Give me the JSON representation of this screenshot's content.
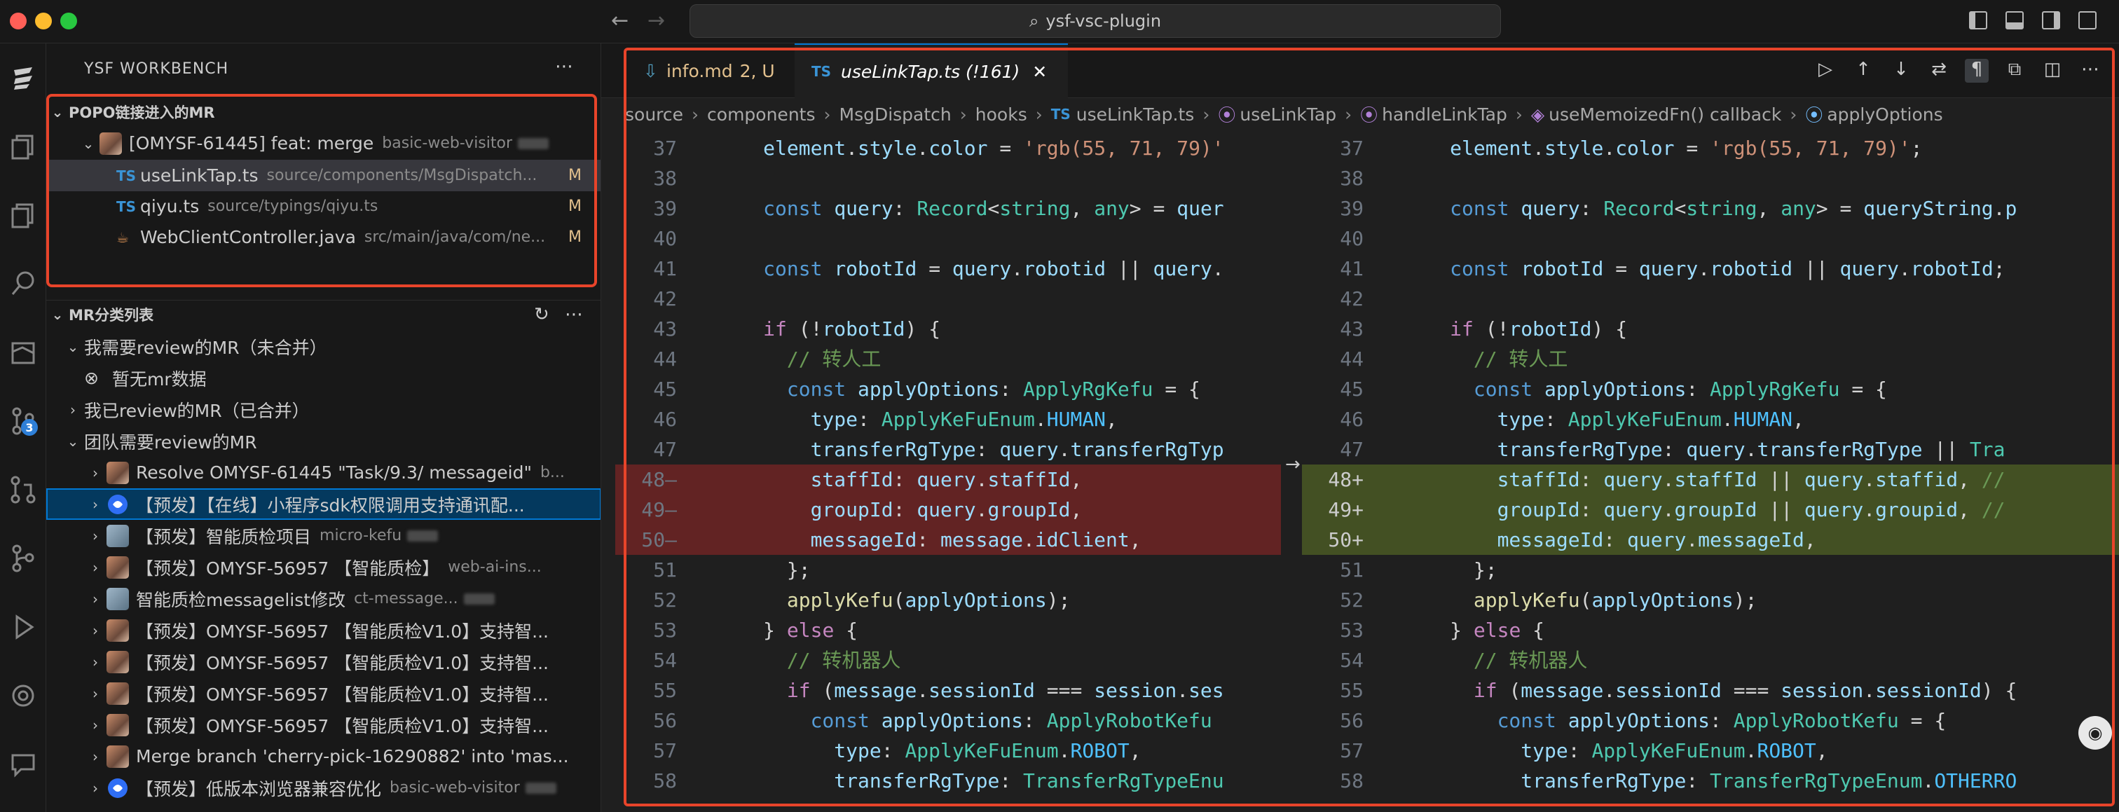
{
  "window": {
    "search_text": "ysf-vsc-plugin"
  },
  "activity": {
    "source_control_badge": "3"
  },
  "sidebar": {
    "title": "YSF WORKBENCH",
    "popo_section": {
      "header": "POPO链接进入的MR",
      "mr": {
        "title": "[OMYSF-61445] feat: merge",
        "branch": "basic-web-visitor"
      },
      "files": [
        {
          "icon": "TS",
          "name": "useLinkTap.ts",
          "path": "source/components/MsgDispatch...",
          "status": "M"
        },
        {
          "icon": "TS",
          "name": "qiyu.ts",
          "path": "source/typings/qiyu.ts",
          "status": "M"
        },
        {
          "icon": "java",
          "name": "WebClientController.java",
          "path": "src/main/java/com/ne...",
          "status": "M"
        }
      ]
    },
    "mr_section": {
      "header": "MR分类列表",
      "groups": [
        {
          "label": "我需要review的MR（未合并）"
        },
        {
          "label": "暂无mr数据"
        },
        {
          "label": "我已review的MR（已合并）"
        },
        {
          "label": "团队需要review的MR"
        }
      ],
      "items": [
        {
          "title": "Resolve OMYSF-61445 \"Task/9.3/ messageid\"",
          "desc": "b..."
        },
        {
          "title": "【预发】【在线】小程序sdk权限调用支持通讯配...",
          "desc": ""
        },
        {
          "title": "【预发】智能质检项目",
          "desc": "micro-kefu"
        },
        {
          "title": "【预发】OMYSF-56957 【智能质检】",
          "desc": "web-ai-ins..."
        },
        {
          "title": "智能质检messagelist修改",
          "desc": "ct-message..."
        },
        {
          "title": "【预发】OMYSF-56957 【智能质检V1.0】支持智...",
          "desc": ""
        },
        {
          "title": "【预发】OMYSF-56957 【智能质检V1.0】支持智...",
          "desc": ""
        },
        {
          "title": "【预发】OMYSF-56957 【智能质检V1.0】支持智...",
          "desc": ""
        },
        {
          "title": "【预发】OMYSF-56957 【智能质检V1.0】支持智...",
          "desc": ""
        },
        {
          "title": "Merge branch 'cherry-pick-16290882' into 'mas...",
          "desc": ""
        },
        {
          "title": "【预发】低版本浏览器兼容优化",
          "desc": "basic-web-visitor"
        }
      ]
    }
  },
  "editor": {
    "tabs": [
      {
        "name": "info.md",
        "meta": "2, U"
      },
      {
        "name": "useLinkTap.ts (!161)",
        "close": "✕"
      }
    ],
    "breadcrumb": [
      "source",
      "components",
      "MsgDispatch",
      "hooks",
      "useLinkTap.ts",
      "useLinkTap",
      "handleLinkTap",
      "useMemoizedFn() callback",
      "applyOptions"
    ],
    "line_numbers": [
      "37",
      "38",
      "39",
      "40",
      "41",
      "42",
      "43",
      "44",
      "45",
      "46",
      "47",
      "48",
      "49",
      "50",
      "51",
      "52",
      "53",
      "54",
      "55",
      "56",
      "57",
      "58"
    ],
    "left_lines": [
      "      element.style.color = 'rgb(55, 71, 79)'",
      "",
      "      const query: Record<string, any> = quer",
      "",
      "      const robotId = query.robotid || query.",
      "",
      "      if (!robotId) {",
      "        // 转人工",
      "        const applyOptions: ApplyRgKefu = {",
      "          type: ApplyKeFuEnum.HUMAN,",
      "          transferRgType: query.transferRgTyp",
      "          staffId: query.staffId,",
      "          groupId: query.groupId,",
      "          messageId: message.idClient,",
      "        };",
      "        applyKefu(applyOptions);",
      "      } else {",
      "        // 转机器人",
      "        if (message.sessionId === session.ses",
      "          const applyOptions: ApplyRobotKefu",
      "            type: ApplyKeFuEnum.ROBOT,",
      "            transferRgType: TransferRgTypeEnu"
    ],
    "right_lines": [
      "      element.style.color = 'rgb(55, 71, 79)';",
      "",
      "      const query: Record<string, any> = queryString.p",
      "",
      "      const robotId = query.robotid || query.robotId;",
      "",
      "      if (!robotId) {",
      "        // 转人工",
      "        const applyOptions: ApplyRgKefu = {",
      "          type: ApplyKeFuEnum.HUMAN,",
      "          transferRgType: query.transferRgType || Tra",
      "          staffId: query.staffId || query.staffid, //",
      "          groupId: query.groupId || query.groupid, //",
      "          messageId: query.messageId,",
      "        };",
      "        applyKefu(applyOptions);",
      "      } else {",
      "        // 转机器人",
      "        if (message.sessionId === session.sessionId) {",
      "          const applyOptions: ApplyRobotKefu = {",
      "            type: ApplyKeFuEnum.ROBOT,",
      "            transferRgType: TransferRgTypeEnum.OTHERRO"
    ],
    "diff_markers": {
      "48": "+",
      "49": "+",
      "50": "+"
    },
    "left_markers": {
      "48": "—",
      "49": "—",
      "50": "—"
    },
    "arrow": "→"
  },
  "colors": {
    "accent": "#0078d4",
    "highlight": "#e8442a",
    "modified": "#e2c08d"
  }
}
